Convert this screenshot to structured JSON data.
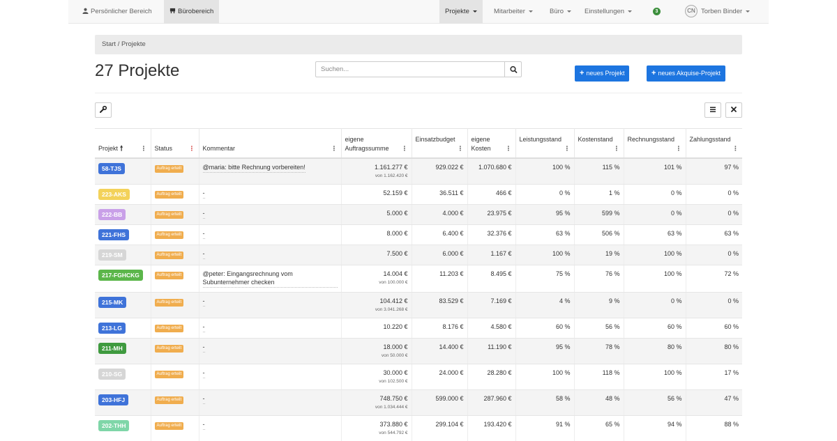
{
  "nav": {
    "left": [
      {
        "label": "Persönlicher Bereich",
        "icon": "person-icon"
      },
      {
        "label": "Bürobereich",
        "icon": "office-icon"
      }
    ],
    "right": [
      {
        "label": "Projekte"
      },
      {
        "label": "Mitarbeiter"
      },
      {
        "label": "Büro"
      },
      {
        "label": "Einstellungen"
      }
    ],
    "notification_count": "3",
    "user": {
      "initials": "CN",
      "name": "Torben Binder"
    }
  },
  "breadcrumb": "Start / Projekte",
  "page_title": "27 Projekte",
  "search": {
    "placeholder": "Suchen...",
    "value": ""
  },
  "buttons": {
    "new_project": "neues Projekt",
    "new_acquisition": "neues Akquise-Projekt"
  },
  "colors": {
    "primary": "#1d75e0",
    "status_orange": "#f0ad4e"
  },
  "table": {
    "headers": [
      {
        "label": "Projekt",
        "sorted": true
      },
      {
        "label": "Status"
      },
      {
        "label": "Kommentar"
      },
      {
        "label": "eigene Auftragssumme"
      },
      {
        "label": "Einsatzbudget"
      },
      {
        "label": "eigene Kosten"
      },
      {
        "label": "Leistungsstand"
      },
      {
        "label": "Kostenstand"
      },
      {
        "label": "Rechnungsstand"
      },
      {
        "label": "Zahlungsstand"
      }
    ],
    "rows": [
      {
        "project": "58-TJS",
        "color": "#3f73d9",
        "status": "Auftrag erteilt",
        "comment": "@maria: bitte Rechnung vorbereiten!",
        "order_sum": "1.161.277 €",
        "order_sub": "von 1.162.420 €",
        "budget": "929.022 €",
        "costs": "1.070.680 €",
        "perf": "100 %",
        "cost_level": "115 %",
        "invoice_level": "101 %",
        "payment_level": "97 %"
      },
      {
        "project": "223-AKS",
        "color": "#f3d25a",
        "status": "Auftrag erteilt",
        "comment": "-",
        "order_sum": "52.159 €",
        "order_sub": "",
        "budget": "36.511 €",
        "costs": "466 €",
        "perf": "0 %",
        "cost_level": "1 %",
        "invoice_level": "0 %",
        "payment_level": "0 %"
      },
      {
        "project": "222-BB",
        "color": "#c9a0e8",
        "status": "Auftrag erteilt",
        "comment": "-",
        "order_sum": "5.000 €",
        "order_sub": "",
        "budget": "4.000 €",
        "costs": "23.975 €",
        "perf": "95 %",
        "cost_level": "599 %",
        "invoice_level": "0 %",
        "payment_level": "0 %"
      },
      {
        "project": "221-FHS",
        "color": "#3f73d9",
        "status": "Auftrag erteilt",
        "comment": "-",
        "order_sum": "8.000 €",
        "order_sub": "",
        "budget": "6.400 €",
        "costs": "32.376 €",
        "perf": "63 %",
        "cost_level": "506 %",
        "invoice_level": "63 %",
        "payment_level": "63 %"
      },
      {
        "project": "219-SM",
        "color": "#d6d6d6",
        "status": "Auftrag erteilt",
        "comment": "-",
        "order_sum": "7.500 €",
        "order_sub": "",
        "budget": "6.000 €",
        "costs": "1.167 €",
        "perf": "100 %",
        "cost_level": "19 %",
        "invoice_level": "100 %",
        "payment_level": "0 %"
      },
      {
        "project": "217-FGHCKG",
        "color": "#5bb64a",
        "status": "Auftrag erteilt",
        "comment": "@peter: Eingangsrechnung vom Subunternehmer checken",
        "order_sum": "14.004 €",
        "order_sub": "von 100.000 €",
        "budget": "11.203 €",
        "costs": "8.495 €",
        "perf": "75 %",
        "cost_level": "76 %",
        "invoice_level": "100 %",
        "payment_level": "72 %"
      },
      {
        "project": "215-MK",
        "color": "#3f73d9",
        "status": "Auftrag erteilt",
        "comment": "-",
        "order_sum": "104.412 €",
        "order_sub": "von 3.041.268 €",
        "budget": "83.529 €",
        "costs": "7.169 €",
        "perf": "4 %",
        "cost_level": "9 %",
        "invoice_level": "0 %",
        "payment_level": "0 %"
      },
      {
        "project": "213-LG",
        "color": "#3f73d9",
        "status": "Auftrag erteilt",
        "comment": "-",
        "order_sum": "10.220 €",
        "order_sub": "",
        "budget": "8.176 €",
        "costs": "4.580 €",
        "perf": "60 %",
        "cost_level": "56 %",
        "invoice_level": "60 %",
        "payment_level": "60 %"
      },
      {
        "project": "211-MH",
        "color": "#3f9a3f",
        "status": "Auftrag erteilt",
        "comment": "-",
        "order_sum": "18.000 €",
        "order_sub": "von 50.000 €",
        "budget": "14.400 €",
        "costs": "11.190 €",
        "perf": "95 %",
        "cost_level": "78 %",
        "invoice_level": "80 %",
        "payment_level": "80 %"
      },
      {
        "project": "210-SG",
        "color": "#d6d6d6",
        "status": "Auftrag erteilt",
        "comment": "-",
        "order_sum": "30.000 €",
        "order_sub": "von 102.500 €",
        "budget": "24.000 €",
        "costs": "28.280 €",
        "perf": "100 %",
        "cost_level": "118 %",
        "invoice_level": "100 %",
        "payment_level": "17 %"
      },
      {
        "project": "203-HFJ",
        "color": "#3f73d9",
        "status": "Auftrag erteilt",
        "comment": "-",
        "order_sum": "748.750 €",
        "order_sub": "von 1.034.444 €",
        "budget": "599.000 €",
        "costs": "287.960 €",
        "perf": "58 %",
        "cost_level": "48 %",
        "invoice_level": "56 %",
        "payment_level": "47 %"
      },
      {
        "project": "202-THH",
        "color": "#7fd6a8",
        "status": "Auftrag erteilt",
        "comment": "-",
        "order_sum": "373.880 €",
        "order_sub": "von 544.792 €",
        "budget": "299.104 €",
        "costs": "193.420 €",
        "perf": "91 %",
        "cost_level": "65 %",
        "invoice_level": "94 %",
        "payment_level": "88 %"
      }
    ]
  }
}
